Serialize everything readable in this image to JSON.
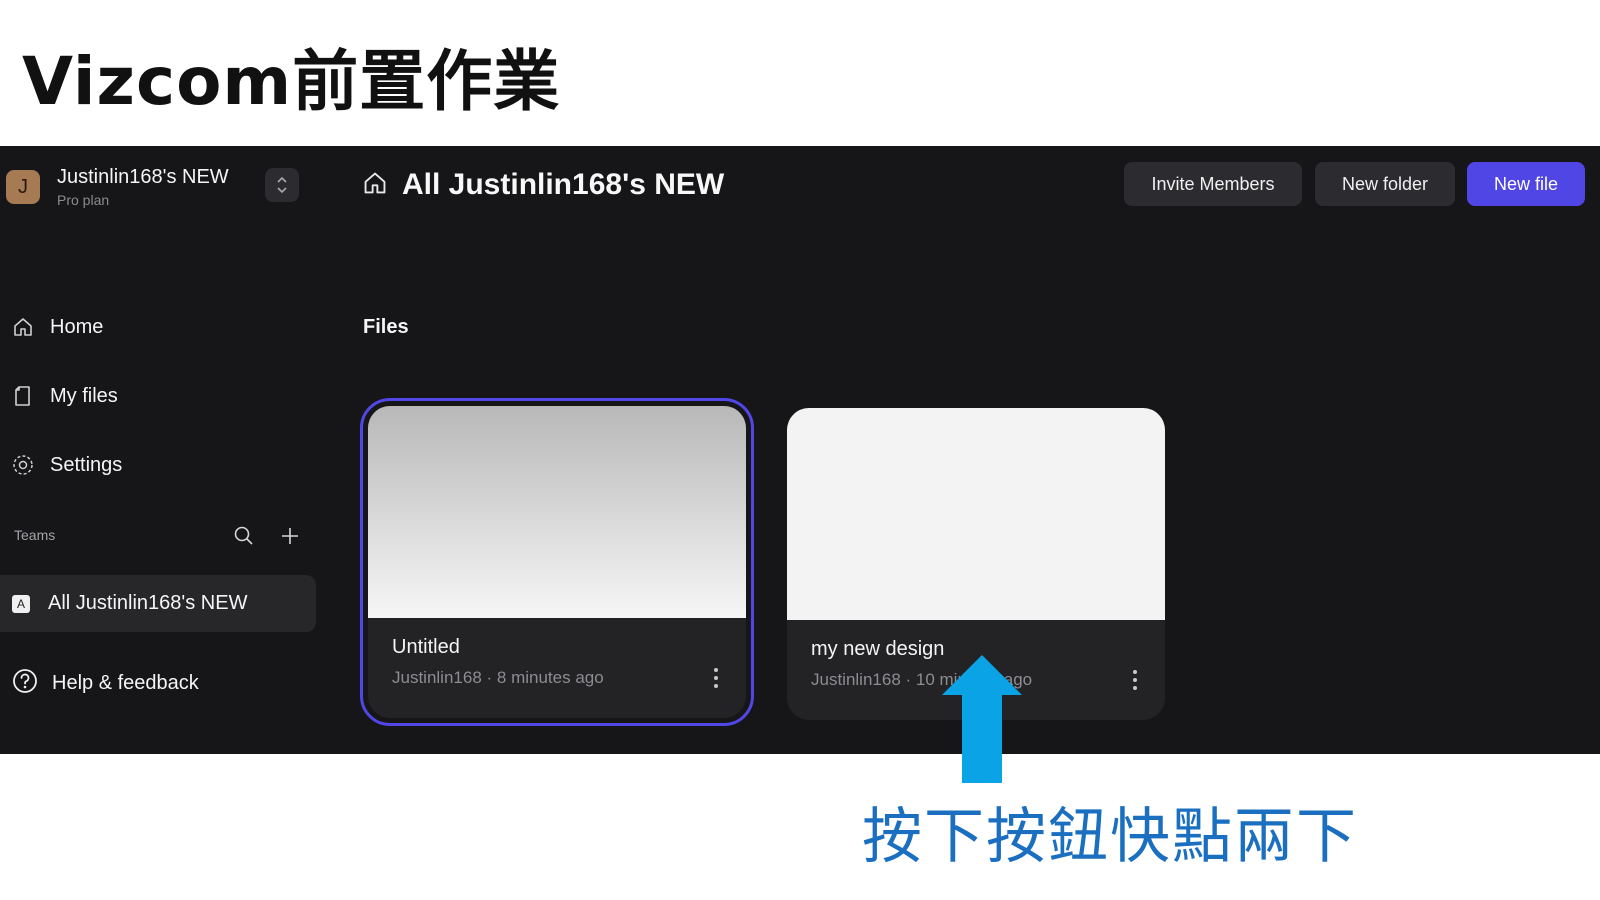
{
  "slide": {
    "title": "Vizcom前置作業",
    "annotation": "按下按鈕快點兩下",
    "annotation_color": "#1b6fc1",
    "arrow_color": "#09a3e6"
  },
  "workspace": {
    "avatar_letter": "J",
    "name": "Justinlin168's NEW",
    "plan": "Pro plan"
  },
  "nav": {
    "home": "Home",
    "my_files": "My files",
    "settings": "Settings"
  },
  "teams": {
    "label": "Teams",
    "items": [
      {
        "badge": "A",
        "name": "All Justinlin168's NEW"
      }
    ]
  },
  "help": {
    "label": "Help & feedback"
  },
  "header": {
    "title": "All Justinlin168's NEW",
    "invite_label": "Invite Members",
    "new_folder_label": "New folder",
    "new_file_label": "New file",
    "accent_color": "#4f46e5"
  },
  "files": {
    "section_label": "Files",
    "items": [
      {
        "title": "Untitled",
        "meta": "Justinlin168 · 8 minutes ago",
        "selected": true
      },
      {
        "title": "my new design",
        "meta": "Justinlin168 · 10 minutes ago",
        "selected": false
      }
    ]
  }
}
